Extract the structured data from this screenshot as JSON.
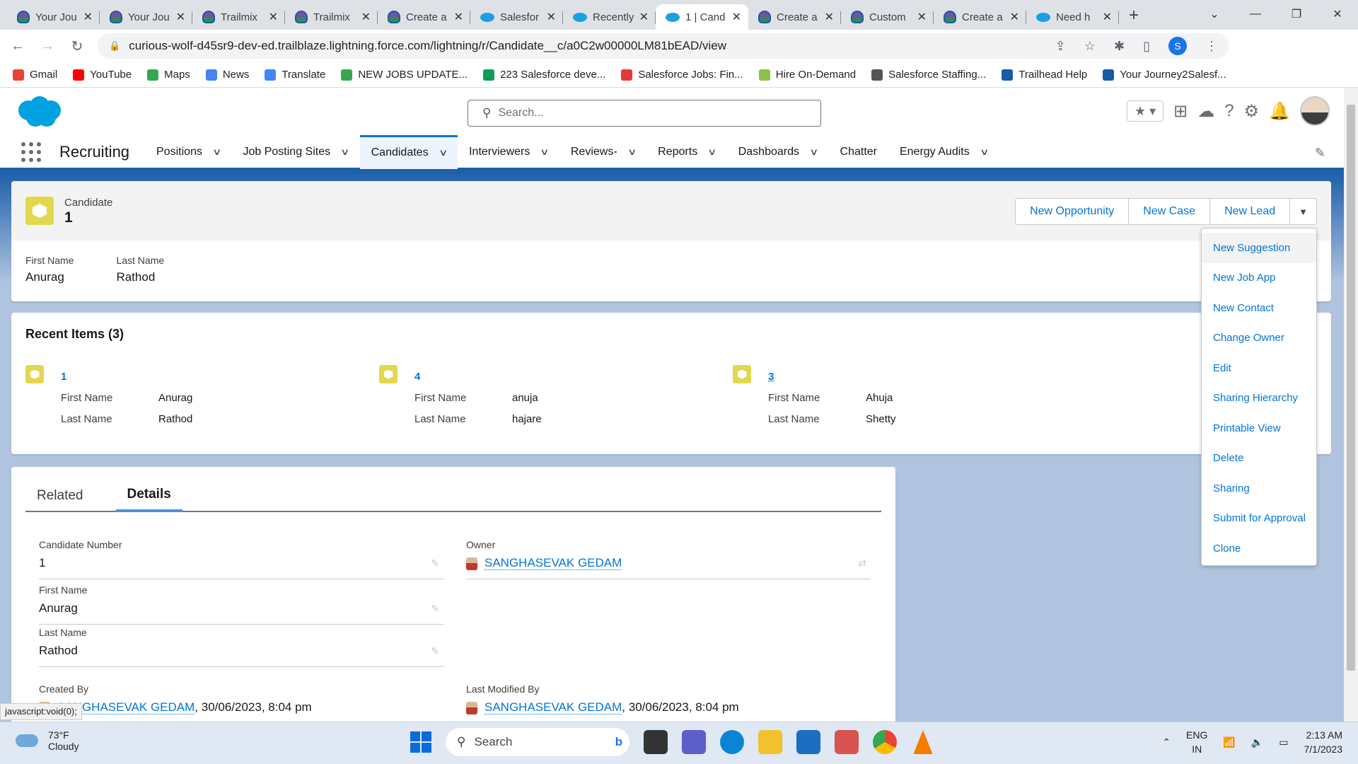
{
  "browser": {
    "tabs": [
      {
        "title": "Your Jou",
        "icon": "trailhead-icon",
        "active": false
      },
      {
        "title": "Your Jou",
        "icon": "trailhead-icon",
        "active": false
      },
      {
        "title": "Trailmix",
        "icon": "trailhead-icon",
        "active": false
      },
      {
        "title": "Trailmix",
        "icon": "trailhead-icon",
        "active": false
      },
      {
        "title": "Create a",
        "icon": "trailhead-icon",
        "active": false
      },
      {
        "title": "Salesfor",
        "icon": "salesforce-icon",
        "active": false
      },
      {
        "title": "Recently",
        "icon": "salesforce-icon",
        "active": false
      },
      {
        "title": "1 | Cand",
        "icon": "salesforce-icon",
        "active": true
      },
      {
        "title": "Create a",
        "icon": "trailhead-icon",
        "active": false
      },
      {
        "title": "Custom",
        "icon": "trailhead-icon",
        "active": false
      },
      {
        "title": "Create a",
        "icon": "trailhead-icon",
        "active": false
      },
      {
        "title": "Need h",
        "icon": "salesforce-icon",
        "active": false
      }
    ],
    "url": "curious-wolf-d45sr9-dev-ed.trailblaze.lightning.force.com/lightning/r/Candidate__c/a0C2w00000LM81bEAD/view",
    "profile_initial": "S",
    "bookmarks": [
      {
        "label": "Gmail",
        "color": "#ea4335"
      },
      {
        "label": "YouTube",
        "color": "#ff0000"
      },
      {
        "label": "Maps",
        "color": "#34a853"
      },
      {
        "label": "News",
        "color": "#4285f4"
      },
      {
        "label": "Translate",
        "color": "#4285f4"
      },
      {
        "label": "NEW JOBS UPDATE...",
        "color": "#34a853"
      },
      {
        "label": "223 Salesforce deve...",
        "color": "#0f9d58"
      },
      {
        "label": "Salesforce Jobs: Fin...",
        "color": "#e53935"
      },
      {
        "label": "Hire On-Demand",
        "color": "#8bc34a"
      },
      {
        "label": "Salesforce Staffing...",
        "color": "#555555"
      },
      {
        "label": "Trailhead Help",
        "color": "#1a5aa8"
      },
      {
        "label": "Your Journey2Salesf...",
        "color": "#1a5aa8"
      }
    ],
    "status_url": "javascript:void(0);"
  },
  "salesforce": {
    "search_placeholder": "Search...",
    "app_name": "Recruiting",
    "nav": [
      {
        "label": "Positions",
        "has_menu": true,
        "active": false
      },
      {
        "label": "Job Posting Sites",
        "has_menu": true,
        "active": false
      },
      {
        "label": "Candidates",
        "has_menu": true,
        "active": true
      },
      {
        "label": "Interviewers",
        "has_menu": true,
        "active": false
      },
      {
        "label": "Reviews-",
        "has_menu": true,
        "active": false
      },
      {
        "label": "Reports",
        "has_menu": true,
        "active": false
      },
      {
        "label": "Dashboards",
        "has_menu": true,
        "active": false
      },
      {
        "label": "Chatter",
        "has_menu": false,
        "active": false
      },
      {
        "label": "Energy Audits",
        "has_menu": true,
        "active": false
      }
    ],
    "record": {
      "type": "Candidate",
      "name": "1",
      "actions": [
        "New Opportunity",
        "New Case",
        "New Lead"
      ],
      "highlights": [
        {
          "label": "First Name",
          "value": "Anurag"
        },
        {
          "label": "Last Name",
          "value": "Rathod"
        }
      ]
    },
    "action_menu": [
      "New Suggestion",
      "New Job App",
      "New Contact",
      "Change Owner",
      "Edit",
      "Sharing Hierarchy",
      "Printable View",
      "Delete",
      "Sharing",
      "Submit for Approval",
      "Clone"
    ],
    "recent": {
      "title": "Recent Items (3)",
      "items": [
        {
          "name": "1",
          "first_label": "First Name",
          "first": "Anurag",
          "last_label": "Last Name",
          "last": "Rathod"
        },
        {
          "name": "4",
          "first_label": "First Name",
          "first": "anuja",
          "last_label": "Last Name",
          "last": "hajare"
        },
        {
          "name": "3",
          "first_label": "First Name",
          "first": "Ahuja",
          "last_label": "Last Name",
          "last": "Shetty"
        }
      ]
    },
    "tabs": {
      "related": "Related",
      "details": "Details"
    },
    "details": {
      "candidate_number_label": "Candidate Number",
      "candidate_number": "1",
      "owner_label": "Owner",
      "owner": "SANGHASEVAK GEDAM",
      "first_name_label": "First Name",
      "first_name": "Anurag",
      "last_name_label": "Last Name",
      "last_name": "Rathod",
      "created_by_label": "Created By",
      "created_by": "SANGHASEVAK GEDAM",
      "created_date": ", 30/06/2023, 8:04 pm",
      "modified_by_label": "Last Modified By",
      "modified_by": "SANGHASEVAK GEDAM",
      "modified_date": ", 30/06/2023, 8:04 pm"
    }
  },
  "taskbar": {
    "weather_temp": "73°F",
    "weather_desc": "Cloudy",
    "search": "Search",
    "lang1": "ENG",
    "lang2": "IN",
    "time": "2:13 AM",
    "date": "7/1/2023"
  }
}
